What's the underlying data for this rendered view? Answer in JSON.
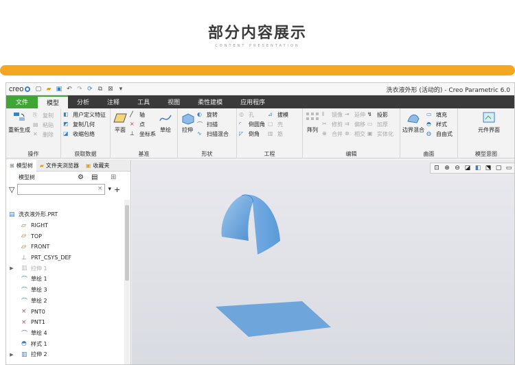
{
  "slide": {
    "title": "部分内容展示",
    "subtitle": "CONTENT PRESENTATION"
  },
  "app": {
    "logo": "creo",
    "window_title": "洗衣液外形 (活动的) - Creo Parametric 6.0"
  },
  "tabs": [
    "文件",
    "模型",
    "分析",
    "注释",
    "工具",
    "视图",
    "柔性建模",
    "应用程序"
  ],
  "ribbon": {
    "operations": {
      "label": "操作",
      "regen": "重新生成",
      "copy": "复制",
      "paste": "粘贴",
      "delete": "删除"
    },
    "get_data": {
      "label": "获取数据",
      "udf": "用户定义特征",
      "copy_geom": "复制几何",
      "shrinkwrap": "收缩包络"
    },
    "datum": {
      "label": "基准",
      "plane": "平面",
      "axis": "轴",
      "point": "点",
      "csys": "坐标系",
      "sketch": "草绘"
    },
    "shapes": {
      "label": "形状",
      "extrude": "拉伸",
      "revolve": "旋转",
      "sweep": "扫描",
      "helical": "扫描混合"
    },
    "engineering": {
      "label": "工程",
      "hole": "孔",
      "round": "倒圆角",
      "chamfer": "倒角",
      "draft": "拔模",
      "shell": "壳",
      "rib": "筋"
    },
    "editing": {
      "label": "编辑",
      "pattern": "阵列",
      "mirror": "镜像",
      "extend": "延伸",
      "project": "投影",
      "trim": "修剪",
      "offset": "偏移",
      "thicken": "加厚",
      "merge": "合并",
      "intersect": "相交",
      "solidify": "实体化"
    },
    "surfaces": {
      "label": "曲面",
      "boundary": "边界混合",
      "fill": "填充",
      "style": "样式",
      "freestyle": "自由式"
    },
    "model_intent": {
      "label": "模型意图",
      "component": "元件界面"
    }
  },
  "panel": {
    "tabs": [
      "模型树",
      "文件夹浏览器",
      "收藏夹"
    ],
    "tree_header": "模型树",
    "filter_placeholder": "",
    "nodes": [
      {
        "label": "洗衣液外形.PRT",
        "icon": "part-icon",
        "expand": ""
      },
      {
        "label": "RIGHT",
        "icon": "datum-plane-icon",
        "expand": ""
      },
      {
        "label": "TOP",
        "icon": "datum-plane-icon",
        "expand": ""
      },
      {
        "label": "FRONT",
        "icon": "datum-plane-icon",
        "expand": ""
      },
      {
        "label": "PRT_CSYS_DEF",
        "icon": "csys-icon",
        "expand": ""
      },
      {
        "label": "拉伸 1",
        "icon": "extrude-icon",
        "expand": "▶",
        "dim": true
      },
      {
        "label": "草绘 1",
        "icon": "sketch-icon",
        "expand": ""
      },
      {
        "label": "草绘 3",
        "icon": "sketch-icon",
        "expand": ""
      },
      {
        "label": "草绘 2",
        "icon": "sketch-icon",
        "expand": ""
      },
      {
        "label": "PNT0",
        "icon": "point-icon",
        "expand": ""
      },
      {
        "label": "PNT1",
        "icon": "point-icon",
        "expand": ""
      },
      {
        "label": "草绘 4",
        "icon": "sketch-icon",
        "expand": ""
      },
      {
        "label": "样式 1",
        "icon": "style-icon",
        "expand": ""
      },
      {
        "label": "拉伸 2",
        "icon": "extrude-icon",
        "expand": "▶"
      }
    ]
  },
  "colors": {
    "accent_green": "#3fa535",
    "orange": "#f5a623",
    "surface_blue": "#6ea6dc"
  }
}
